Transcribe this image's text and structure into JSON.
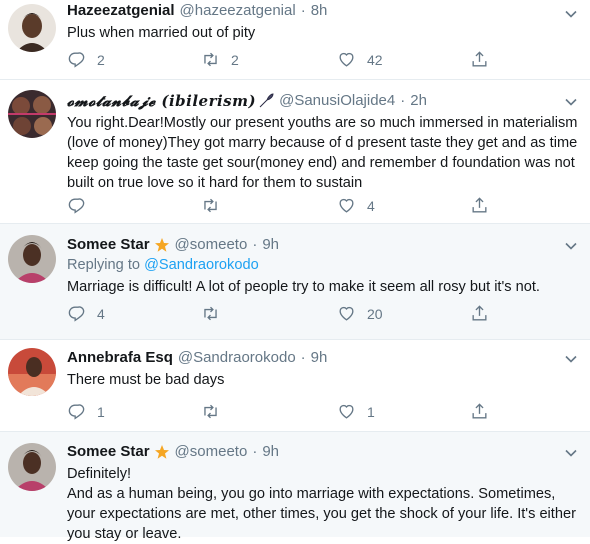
{
  "tweets": [
    {
      "name": "Hazeezatgenial",
      "handle": "@hazeezatgenial",
      "sep": "·",
      "time": "8h",
      "replying_prefix": "",
      "replying_to": "",
      "text": "Plus when married out of pity",
      "replies": "2",
      "retweets": "2",
      "likes": "42"
    },
    {
      "name": "𝓸𝓶𝓸𝓽𝓪𝓷𝓫𝓪𝓳𝓮 (ibilerism)",
      "handle": "@SanusiOlajide4",
      "sep": "·",
      "time": "2h",
      "replying_prefix": "",
      "replying_to": "",
      "text": "You right.Dear!Mostly our present youths are so much immersed in materialism (love of money)They got marry because of d present taste they get and as time keep going the taste get sour(money end) and remember d foundation was not built on true love so it hard for them to sustain",
      "replies": "",
      "retweets": "",
      "likes": "4"
    },
    {
      "name": "Somee Star",
      "handle": "@someeto",
      "sep": "·",
      "time": "9h",
      "replying_prefix": "Replying to ",
      "replying_to": "@Sandraorokodo",
      "text": "Marriage is difficult! A lot of people try to make it seem all rosy but it's not.",
      "replies": "4",
      "retweets": "",
      "likes": "20"
    },
    {
      "name": "Annebrafa Esq",
      "handle": "@Sandraorokodo",
      "sep": "·",
      "time": "9h",
      "replying_prefix": "",
      "replying_to": "",
      "text": "There must be bad days",
      "replies": "1",
      "retweets": "",
      "likes": "1"
    },
    {
      "name": "Somee Star",
      "handle": "@someeto",
      "sep": "·",
      "time": "9h",
      "replying_prefix": "",
      "replying_to": "",
      "text": "Definitely!\nAnd as a human being, you go into marriage with expectations. Sometimes, your expectations are met, other times, you get the shock of your life. It's either you stay or leave.",
      "replies": "",
      "retweets": "",
      "likes": ""
    }
  ],
  "icons": {
    "reply": "reply-icon",
    "retweet": "retweet-icon",
    "like": "like-icon",
    "share": "share-icon",
    "more": "chevron-down-icon",
    "badge": "star-badge-icon",
    "quill": "quill-pen-icon"
  },
  "colors": {
    "muted": "#657786",
    "link": "#1da1f2",
    "badge": "#f5a623",
    "alt_background": "#f5f8fa",
    "divider": "#e6ecf0"
  }
}
